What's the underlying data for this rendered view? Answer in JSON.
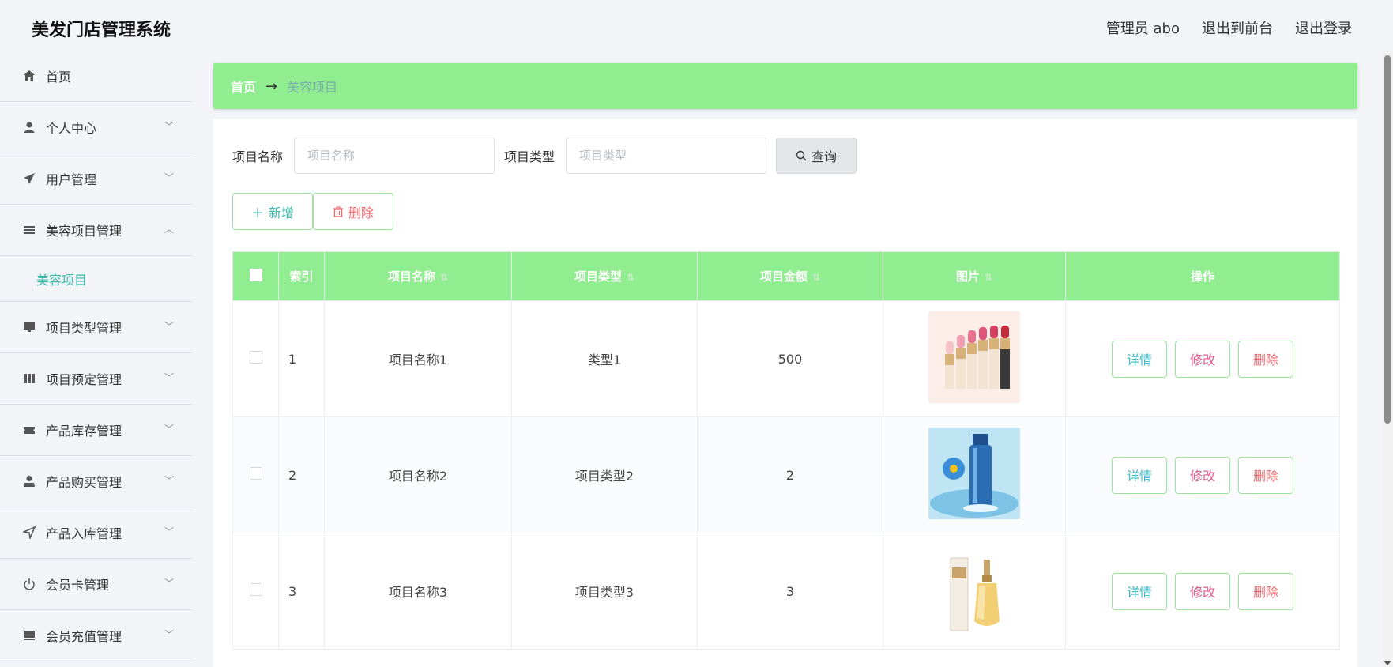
{
  "app": {
    "title": "美发门店管理系统"
  },
  "header": {
    "user": "管理员 abo",
    "to_front": "退出到前台",
    "logout": "退出登录"
  },
  "sidebar": {
    "items": [
      {
        "label": "首页",
        "icon": "home-icon"
      },
      {
        "label": "个人中心",
        "icon": "user-icon"
      },
      {
        "label": "用户管理",
        "icon": "paper-plane-icon"
      },
      {
        "label": "美容项目管理",
        "icon": "list-icon",
        "expanded": true
      },
      {
        "label": "美容项目",
        "sub": true
      },
      {
        "label": "项目类型管理",
        "icon": "monitor-icon"
      },
      {
        "label": "项目预定管理",
        "icon": "book-icon"
      },
      {
        "label": "产品库存管理",
        "icon": "ticket-icon"
      },
      {
        "label": "产品购买管理",
        "icon": "person-icon"
      },
      {
        "label": "产品入库管理",
        "icon": "navigation-icon"
      },
      {
        "label": "会员卡管理",
        "icon": "power-icon"
      },
      {
        "label": "会员充值管理",
        "icon": "wallet-icon"
      }
    ]
  },
  "breadcrumb": {
    "home": "首页",
    "arrow": "→",
    "current": "美容项目"
  },
  "search": {
    "name_label": "项目名称",
    "name_placeholder": "项目名称",
    "type_label": "项目类型",
    "type_placeholder": "项目类型",
    "button": "查询"
  },
  "actions": {
    "add": "新增",
    "delete": "删除"
  },
  "table": {
    "headers": [
      "索引",
      "项目名称",
      "项目类型",
      "项目金额",
      "图片",
      "操作"
    ],
    "rows": [
      {
        "index": "1",
        "name": "项目名称1",
        "type": "类型1",
        "amount": "500",
        "image": "lipstick-image"
      },
      {
        "index": "2",
        "name": "项目名称2",
        "type": "项目类型2",
        "amount": "2",
        "image": "skincare-bottle-image"
      },
      {
        "index": "3",
        "name": "项目名称3",
        "type": "项目类型3",
        "amount": "3",
        "image": "perfume-image"
      }
    ],
    "ops": {
      "detail": "详情",
      "edit": "修改",
      "remove": "删除"
    }
  },
  "colors": {
    "accent": "#90ee90",
    "teal": "#3ab7a8",
    "pink": "#e05b8e",
    "red": "#f0666b"
  }
}
